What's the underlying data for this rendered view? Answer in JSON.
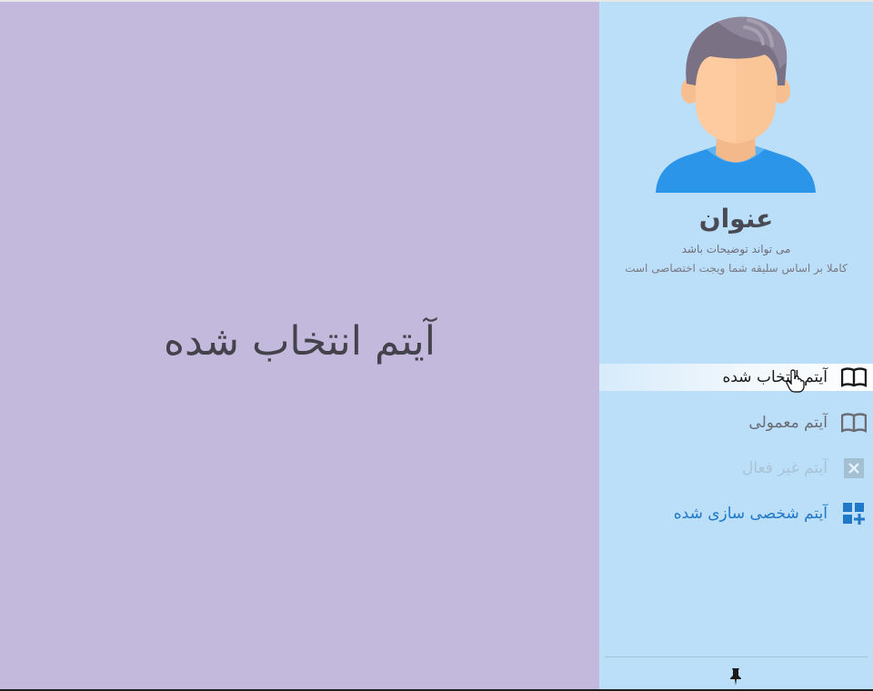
{
  "content": {
    "selected_text": "آیتم انتخاب شده"
  },
  "profile": {
    "avatar_icon": "person-avatar-icon",
    "title": "عنوان",
    "description_line1": "می تواند توضیحات باشد",
    "description_line2": "کاملا بر اساس سلیقه شما ویجت اختصاصی است"
  },
  "menu": {
    "items": [
      {
        "label": "آیتم انتخاب شده",
        "icon": "book-open-icon",
        "state": "selected"
      },
      {
        "label": "آیتم معمولی",
        "icon": "book-open-icon",
        "state": "normal"
      },
      {
        "label": "آیتم غیر فعال",
        "icon": "close-box-icon",
        "state": "disabled"
      },
      {
        "label": "آیتم شخصی سازی شده",
        "icon": "dashboard-add-icon",
        "state": "custom"
      }
    ]
  },
  "footer": {
    "pin_icon": "pin-icon"
  },
  "colors": {
    "content_bg": "#c3b9dd",
    "sidebar_bg": "#bbdef9",
    "custom_accent": "#1f78c8",
    "disabled_text": "#a9c3d6"
  }
}
